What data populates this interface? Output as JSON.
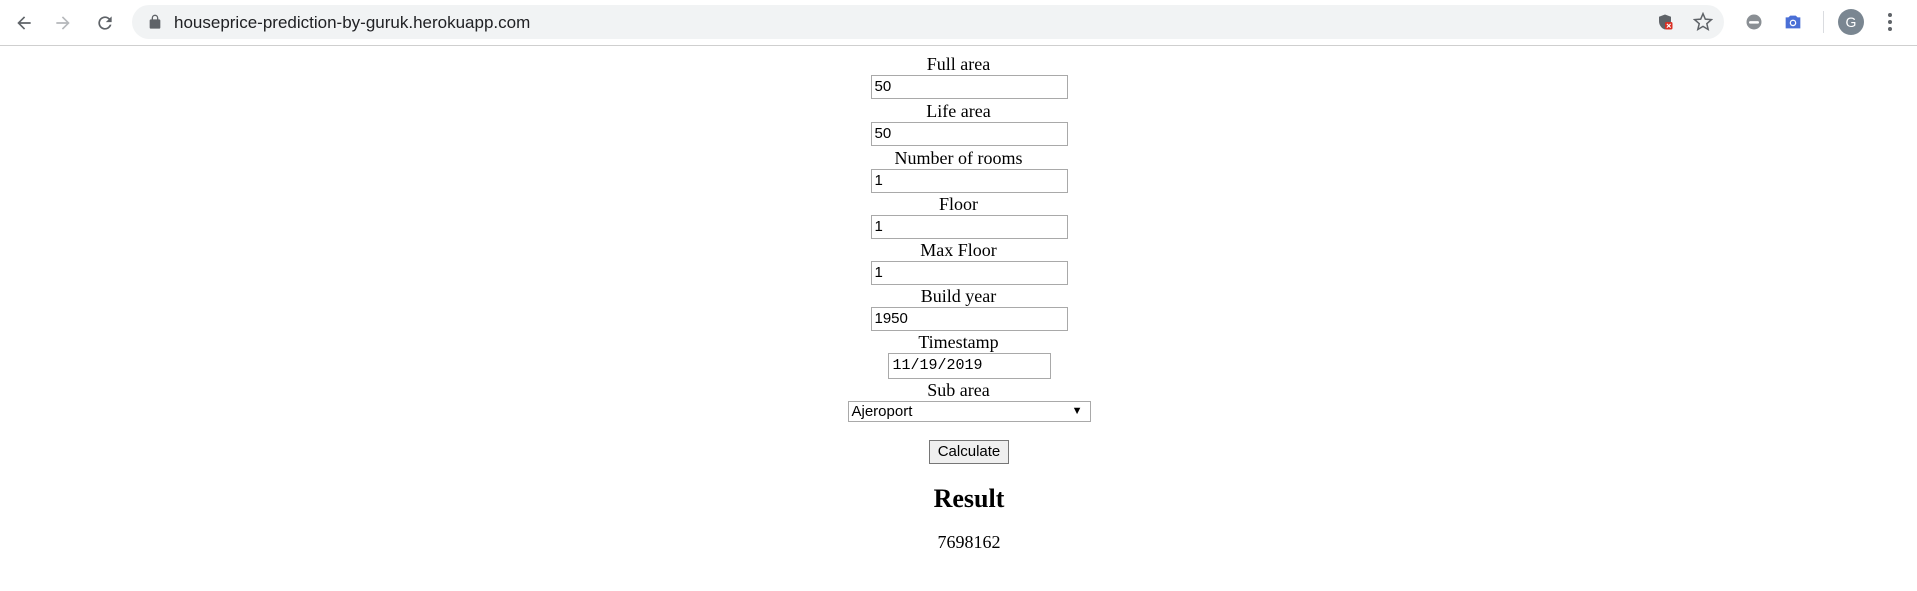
{
  "browser": {
    "url": "houseprice-prediction-by-guruk.herokuapp.com",
    "avatar_letter": "G"
  },
  "form": {
    "fields": [
      {
        "label": "Full area",
        "value": "50"
      },
      {
        "label": "Life area",
        "value": "50"
      },
      {
        "label": "Number of rooms",
        "value": "1"
      },
      {
        "label": "Floor",
        "value": "1"
      },
      {
        "label": "Max Floor",
        "value": "1"
      },
      {
        "label": "Build year",
        "value": "1950"
      }
    ],
    "timestamp": {
      "label": "Timestamp",
      "value": "11/19/2019"
    },
    "sub_area": {
      "label": "Sub area",
      "value": "Ajeroport"
    },
    "calculate_label": "Calculate"
  },
  "result": {
    "heading": "Result",
    "value": "7698162"
  },
  "colors": {
    "chrome_icon": "#5f6368",
    "omnibox_bg": "#f1f3f4",
    "camera_icon": "#4a6fd6",
    "shield_badge": "#d93025"
  }
}
